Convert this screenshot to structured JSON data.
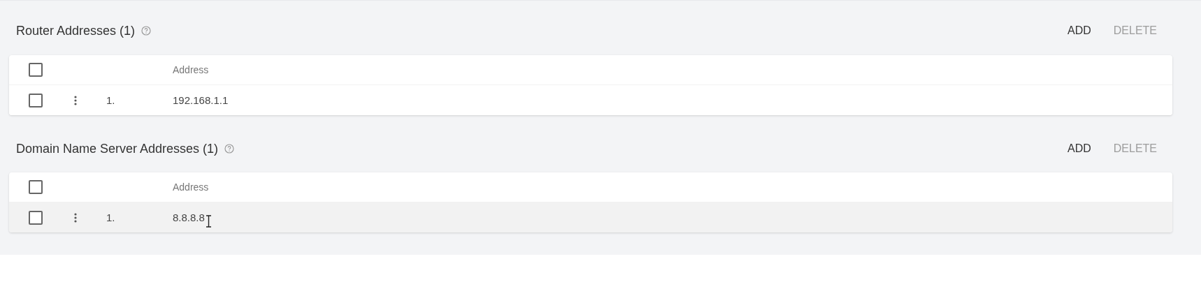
{
  "sections": [
    {
      "title": "Router Addresses (1)",
      "actions": [
        {
          "label": "ADD",
          "disabled": false
        },
        {
          "label": "DELETE",
          "disabled": true
        }
      ],
      "table": {
        "header_checked": false,
        "columns": [
          "Address"
        ],
        "rows": [
          {
            "checked": false,
            "index": "1.",
            "address": "192.168.1.1",
            "hovered": false
          }
        ]
      }
    },
    {
      "title": "Domain Name Server Addresses (1)",
      "actions": [
        {
          "label": "ADD",
          "disabled": false
        },
        {
          "label": "DELETE",
          "disabled": true
        }
      ],
      "table": {
        "header_checked": false,
        "columns": [
          "Address"
        ],
        "rows": [
          {
            "checked": false,
            "index": "1.",
            "address": "8.8.8.8",
            "hovered": true
          }
        ]
      }
    }
  ]
}
